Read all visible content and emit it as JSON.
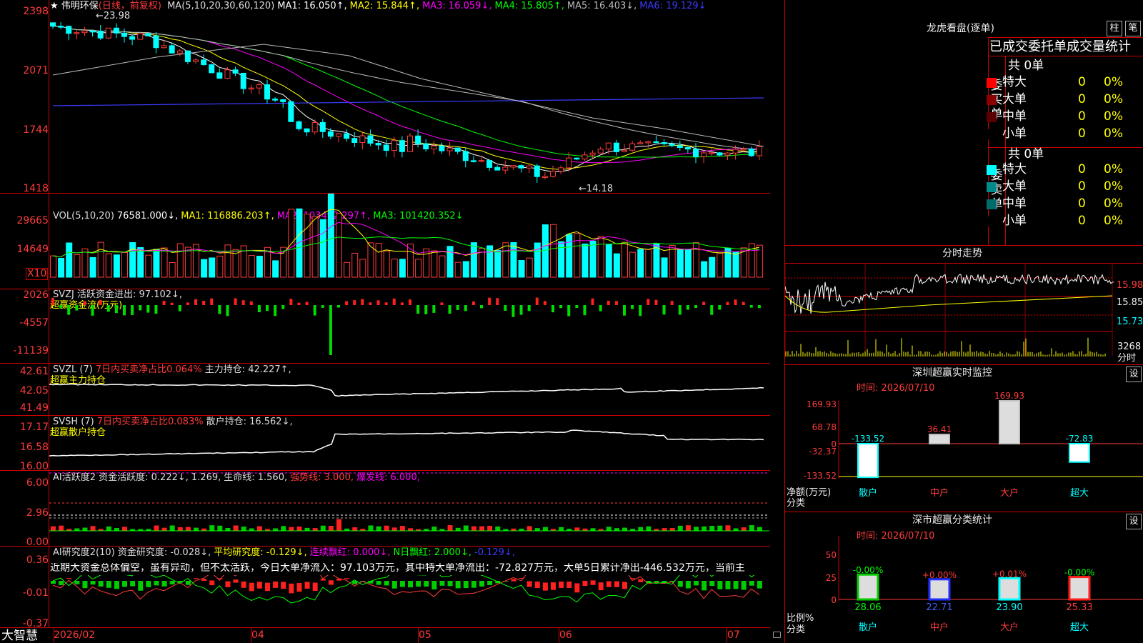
{
  "stock": {
    "name": "★ 伟明环保",
    "period": "(日线，前复权)"
  },
  "main_header": [
    {
      "text": "MA(5,10,20,30,60,120)",
      "color": "#dddddd"
    },
    {
      "text": "MA1: 16.050↑,",
      "color": "#ffffff"
    },
    {
      "text": "MA2: 15.844↑,",
      "color": "#ffff00"
    },
    {
      "text": "MA3: 16.059↓,",
      "color": "#ff00ff"
    },
    {
      "text": "MA4: 15.805↑,",
      "color": "#00ff00"
    },
    {
      "text": "MA5: 16.403↓,",
      "color": "#bbbbbb"
    },
    {
      "text": "MA6: 19.129↓",
      "color": "#3b3bff"
    }
  ],
  "price_axis": [
    "2398",
    "2071",
    "1744",
    "1418"
  ],
  "price_high_label": "←23.98",
  "price_low_label": "←14.18",
  "vol_header": [
    {
      "text": "VOL(5,10,20)",
      "color": "#dddddd"
    },
    {
      "text": "76581.000↓,",
      "color": "#ffffff"
    },
    {
      "text": "MA1: 116886.203↑,",
      "color": "#ffff00"
    },
    {
      "text": "MA2: 103492.297↑,",
      "color": "#ff00ff"
    },
    {
      "text": "MA3: 101420.352↓",
      "color": "#00ff00"
    }
  ],
  "vol_axis": [
    "29665",
    "14649"
  ],
  "vol_unit": "X10",
  "svzj_header": [
    {
      "text": "SVZJ 活跃资金进出: 97.102↓,",
      "color": "#dddddd"
    }
  ],
  "svzj_sub": "超赢资金流(万元)",
  "svzj_axis": [
    "2026",
    "-4557",
    "-11139"
  ],
  "svzl_header": [
    {
      "text": "SVZL (7)",
      "color": "#dddddd"
    },
    {
      "text": "7日内买卖净占比0.064%",
      "color": "#ff3b3b"
    },
    {
      "text": "主力持仓: 42.227↑,",
      "color": "#dddddd"
    }
  ],
  "svzl_sub": "超赢主力持仓",
  "svzl_axis": [
    "42.61",
    "42.05",
    "41.49"
  ],
  "svsh_header": [
    {
      "text": "SVSH (7)",
      "color": "#dddddd"
    },
    {
      "text": "7日内买卖净占比0.083%",
      "color": "#ff3b3b"
    },
    {
      "text": "散户持仓: 16.562↓,",
      "color": "#dddddd"
    }
  ],
  "svsh_sub": "超赢散户持仓",
  "svsh_axis": [
    "17.17",
    "16.58",
    "16.00"
  ],
  "ai_header": [
    {
      "text": "AI活跃度2 资金活跃度: 0.222↓,",
      "color": "#dddddd"
    },
    {
      "text": "1.269,",
      "color": "#dddddd"
    },
    {
      "text": "生命线: 1.560,",
      "color": "#dddddd"
    },
    {
      "text": "强势线: 3.000,",
      "color": "#ff3b3b"
    },
    {
      "text": "爆发线: 6.000,",
      "color": "#ff00ff"
    }
  ],
  "ai_axis": [
    "6.00",
    "2.96",
    "0.00"
  ],
  "res_header": [
    {
      "text": "AI研究度2(10) 资金研究度: -0.028↓,",
      "color": "#dddddd"
    },
    {
      "text": "平均研究度: -0.129↓,",
      "color": "#ffff00"
    },
    {
      "text": "连续飘红: 0.000↓,",
      "color": "#ff00ff"
    },
    {
      "text": "N日飘红: 2.000↓,",
      "color": "#00ff00"
    },
    {
      "text": "-0.129↓,",
      "color": "#3b3bff"
    }
  ],
  "res_text": "近期大资金总体偏空，虽有异动，但不太活跃，今日大单净流入：97.103万元，其中特大单净流出：-72.827万元，大单5日累计净出-446.532万元，当前主",
  "res_axis": [
    "0.36",
    "-0.01",
    "-0.37"
  ],
  "date_axis": [
    "2026/02",
    "04",
    "05",
    "06",
    "07"
  ],
  "brand": "大智慧",
  "right": {
    "lhb_title": "龙虎看盘(逐单)",
    "btn_zhu": "柱",
    "btn_bi": "笔",
    "stat_title": "已成交委托单成交量统计",
    "buy_label": "委买单",
    "sell_label": "委卖单",
    "buy_total": "共 0单",
    "sell_total": "共 0单",
    "buy_rows": [
      {
        "label": "特大",
        "count": "0",
        "pct": "0%",
        "color": "#ff0000"
      },
      {
        "label": "大单",
        "count": "0",
        "pct": "0%",
        "color": "#8b0000"
      },
      {
        "label": "中单",
        "count": "0",
        "pct": "0%",
        "color": "#5a0000"
      },
      {
        "label": "小单",
        "count": "0",
        "pct": "0%",
        "color": "#000000"
      }
    ],
    "sell_rows": [
      {
        "label": "特大",
        "count": "0",
        "pct": "0%",
        "color": "#00ffff"
      },
      {
        "label": "大单",
        "count": "0",
        "pct": "0%",
        "color": "#008b8b"
      },
      {
        "label": "中单",
        "count": "0",
        "pct": "0%",
        "color": "#006b6b"
      },
      {
        "label": "小单",
        "count": "0",
        "pct": "0%",
        "color": "#000000"
      }
    ],
    "intraday_title": "分时走势",
    "intraday_axis": [
      "15.98",
      "15.85",
      "15.73"
    ],
    "intraday_vol": "3268",
    "intraday_vol_unit": "分时",
    "monitor_title": "深圳超赢实时监控",
    "monitor_time": "时间: 2026/07/10",
    "monitor_btn": "设",
    "monitor_axis": [
      "169.93",
      "68.78",
      "0",
      "-32.37",
      "-133.52"
    ],
    "monitor_ylabel": "净额(万元)",
    "monitor_xlabel": "分类",
    "monitor_cats": [
      "散户",
      "中户",
      "大户",
      "超大"
    ],
    "monitor_values": [
      "-133.52",
      "36.41",
      "169.93",
      "-72.83"
    ],
    "class_title": "深市超赢分类统计",
    "class_time": "时间: 2026/07/10",
    "class_btn": "设",
    "class_axis": [
      "75",
      "50",
      "25",
      "0"
    ],
    "class_ylabel": "比例%",
    "class_xlabel": "分类",
    "class_cats": [
      "散户",
      "中户",
      "大户",
      "超大"
    ],
    "class_changes": [
      "-0.00%",
      "+0.00%",
      "+0.01%",
      "-0.00%"
    ],
    "class_values": [
      "28.06",
      "22.71",
      "23.90",
      "25.33"
    ]
  }
}
